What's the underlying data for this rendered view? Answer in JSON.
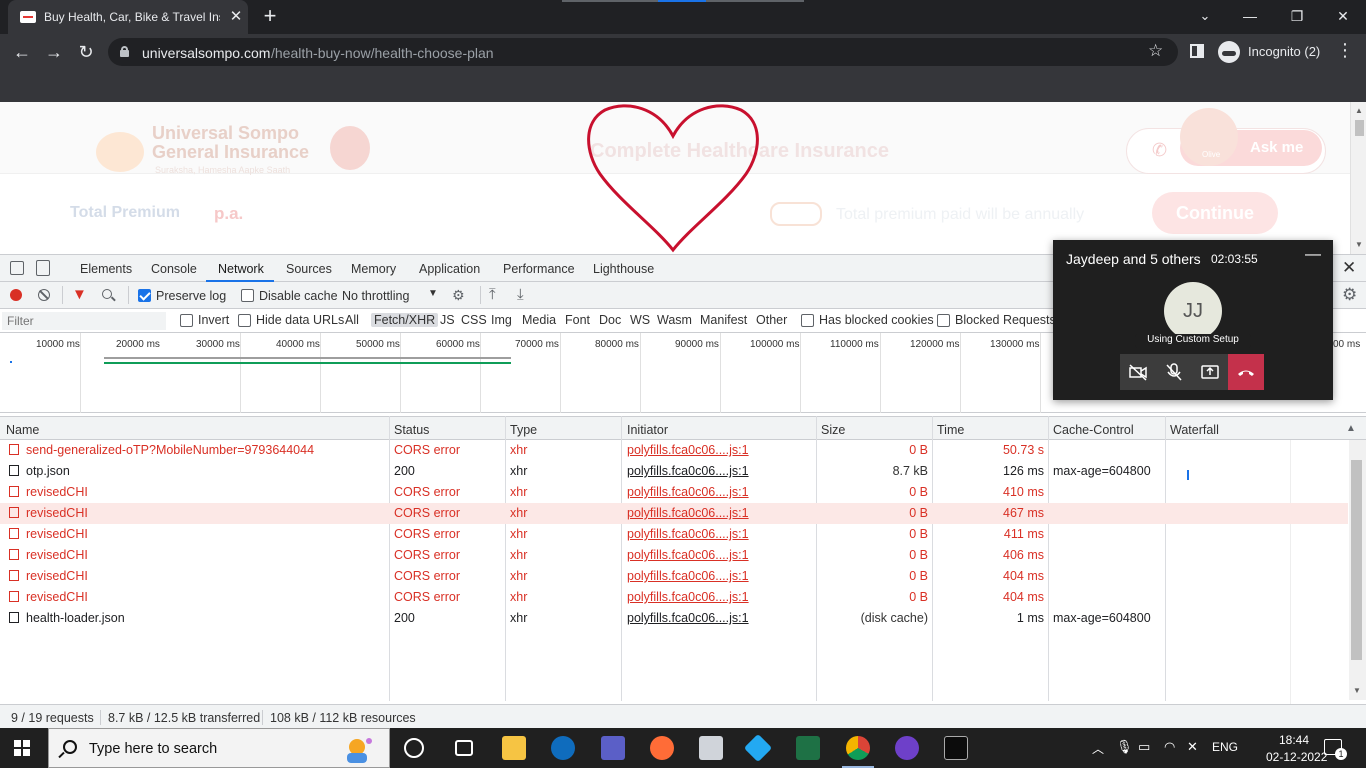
{
  "browser": {
    "tab_title": "Buy Health, Car, Bike & Travel Ins",
    "tab_close": "✕",
    "new_tab": "+",
    "minimize": "—",
    "restore": "❐",
    "close_window": "✕",
    "url_host": "universalsompo.com",
    "url_path": "/health-buy-now/health-choose-plan",
    "profile_label": "Incognito (2)",
    "icons": [
      "back-icon",
      "forward-icon",
      "reload-icon",
      "lock-icon",
      "star-icon",
      "side-panel-icon",
      "incognito-icon",
      "menu-icon"
    ]
  },
  "page": {
    "logo_line1": "Universal Sompo",
    "logo_line2": "General Insurance",
    "logo_tagline": "Suraksha, Hamesha Aapke Saath",
    "title": "Complete Healthcare Insurance",
    "ask_label": "Ask me",
    "avatar_caption": "Olive",
    "total_label": "Total Premium",
    "total_suffix": "p.a.",
    "annual_note": "Total premium paid will be annually",
    "continue_label": "Continue",
    "heart_color": "#c8102e"
  },
  "devtools": {
    "tabs": [
      "Elements",
      "Console",
      "Network",
      "Sources",
      "Memory",
      "Application",
      "Performance",
      "Lighthouse"
    ],
    "active_tab": "Network",
    "preserve_log": "Preserve log",
    "disable_cache": "Disable cache",
    "throttling": "No throttling",
    "filter_placeholder": "Filter",
    "invert": "Invert",
    "hide_data_urls": "Hide data URLs",
    "type_filters": [
      "All",
      "Fetch/XHR",
      "JS",
      "CSS",
      "Img",
      "Media",
      "Font",
      "Doc",
      "WS",
      "Wasm",
      "Manifest",
      "Other"
    ],
    "active_type": "Fetch/XHR",
    "has_blocked_cookies": "Has blocked cookies",
    "blocked_requests": "Blocked Requests",
    "overview_ticks": [
      "10000 ms",
      "20000 ms",
      "30000 ms",
      "40000 ms",
      "50000 ms",
      "60000 ms",
      "70000 ms",
      "80000 ms",
      "90000 ms",
      "100000 ms",
      "110000 ms",
      "120000 ms",
      "130000 ms",
      "00 ms"
    ],
    "columns": [
      "Name",
      "Status",
      "Type",
      "Initiator",
      "Size",
      "Time",
      "Cache-Control",
      "Waterfall"
    ],
    "requests": [
      {
        "name": "send-generalized-oTP?MobileNumber=9793644044",
        "status": "CORS error",
        "type": "xhr",
        "initiator": "polyfills.fca0c06....js:1",
        "size": "0 B",
        "time": "50.73 s",
        "cache": "",
        "error": true,
        "selected": false
      },
      {
        "name": "otp.json",
        "status": "200",
        "type": "xhr",
        "initiator": "polyfills.fca0c06....js:1",
        "size": "8.7 kB",
        "time": "126 ms",
        "cache": "max-age=604800",
        "error": false,
        "selected": false
      },
      {
        "name": "revisedCHI",
        "status": "CORS error",
        "type": "xhr",
        "initiator": "polyfills.fca0c06....js:1",
        "size": "0 B",
        "time": "410 ms",
        "cache": "",
        "error": true,
        "selected": false
      },
      {
        "name": "revisedCHI",
        "status": "CORS error",
        "type": "xhr",
        "initiator": "polyfills.fca0c06....js:1",
        "size": "0 B",
        "time": "467 ms",
        "cache": "",
        "error": true,
        "selected": true
      },
      {
        "name": "revisedCHI",
        "status": "CORS error",
        "type": "xhr",
        "initiator": "polyfills.fca0c06....js:1",
        "size": "0 B",
        "time": "411 ms",
        "cache": "",
        "error": true,
        "selected": false
      },
      {
        "name": "revisedCHI",
        "status": "CORS error",
        "type": "xhr",
        "initiator": "polyfills.fca0c06....js:1",
        "size": "0 B",
        "time": "406 ms",
        "cache": "",
        "error": true,
        "selected": false
      },
      {
        "name": "revisedCHI",
        "status": "CORS error",
        "type": "xhr",
        "initiator": "polyfills.fca0c06....js:1",
        "size": "0 B",
        "time": "404 ms",
        "cache": "",
        "error": true,
        "selected": false
      },
      {
        "name": "revisedCHI",
        "status": "CORS error",
        "type": "xhr",
        "initiator": "polyfills.fca0c06....js:1",
        "size": "0 B",
        "time": "404 ms",
        "cache": "",
        "error": true,
        "selected": false
      },
      {
        "name": "health-loader.json",
        "status": "200",
        "type": "xhr",
        "initiator": "polyfills.fca0c06....js:1",
        "size": "(disk cache)",
        "time": "1 ms",
        "cache": "max-age=604800",
        "error": false,
        "selected": false
      }
    ],
    "status_requests": "9 / 19 requests",
    "status_transferred": "8.7 kB / 12.5 kB transferred",
    "status_resources": "108 kB / 112 kB resources",
    "colors": {
      "error": "#d93025",
      "accent": "#1a73e8",
      "selected_row": "#fce8e6"
    }
  },
  "call": {
    "title": "Jaydeep and 5 others",
    "timer": "02:03:55",
    "minimize": "—",
    "initials": "JJ",
    "setup_label": "Using Custom Setup",
    "buttons": [
      "camera-off-icon",
      "mic-off-icon",
      "share-screen-icon",
      "hang-up-icon"
    ],
    "hangup_color": "#c4314b"
  },
  "taskbar": {
    "search_placeholder": "Type here to search",
    "apps": [
      "cortana-icon",
      "task-view-icon",
      "file-explorer-icon",
      "outlook-icon",
      "teams-icon",
      "postman-icon",
      "app-icon",
      "vscode-icon",
      "excel-icon",
      "chrome-icon",
      "github-icon",
      "terminal-icon"
    ],
    "lang": "ENG",
    "time": "18:44",
    "date": "02-12-2022",
    "notifications": "1"
  }
}
